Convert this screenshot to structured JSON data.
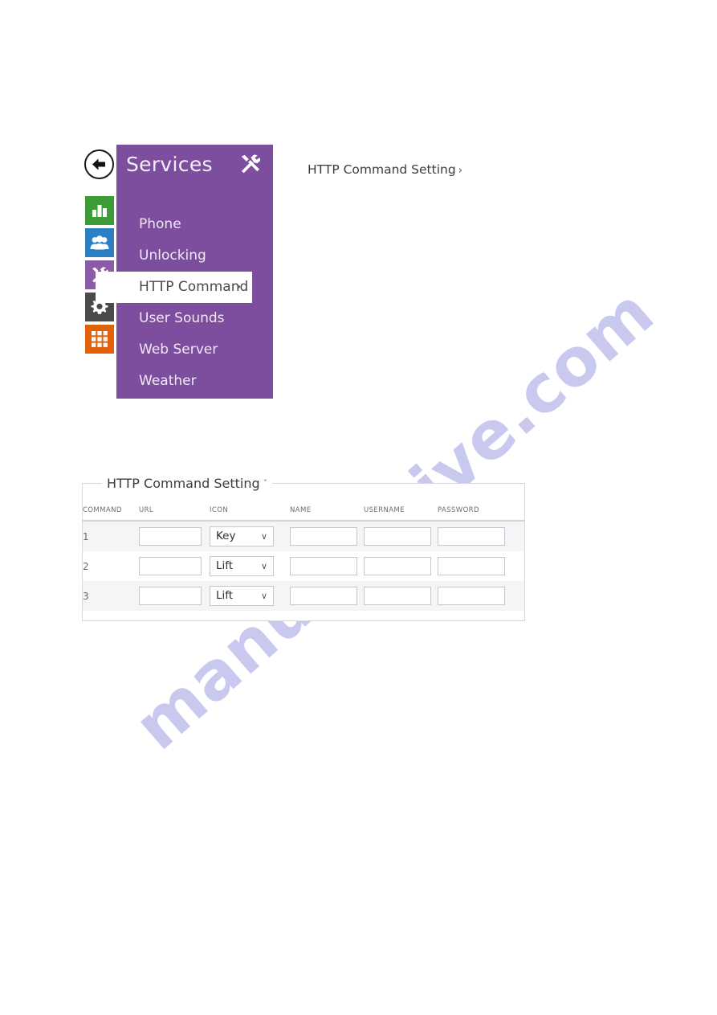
{
  "watermark": {
    "text": "manualshive.com",
    "color": "#c9c9ef"
  },
  "menu_widget": {
    "back_button_icon": "arrow-left-icon",
    "header": {
      "title": "Services",
      "icon": "tools-icon"
    },
    "icon_rail": [
      {
        "name": "status-bar-chart-icon",
        "color": "#3d9b38"
      },
      {
        "name": "directory-users-icon",
        "color": "#2d7fc4"
      },
      {
        "name": "services-tools-icon",
        "color": "#8a5ca8"
      },
      {
        "name": "system-gear-icon",
        "color": "#4a4a4a"
      },
      {
        "name": "apps-grid-icon",
        "color": "#e1600a"
      }
    ],
    "items": [
      {
        "label": "Phone",
        "active": false
      },
      {
        "label": "Unlocking",
        "active": false
      },
      {
        "label": "HTTP Command",
        "active": true,
        "chevron": "›"
      },
      {
        "label": "User Sounds",
        "active": false
      },
      {
        "label": "Web Server",
        "active": false
      },
      {
        "label": "Weather",
        "active": false
      }
    ],
    "panel_color": "#7d4e9e"
  },
  "caption": {
    "text": "HTTP Command Setting",
    "chevron": "›"
  },
  "table_panel": {
    "title": "HTTP Command Setting",
    "title_chevron": "ˇ",
    "columns": [
      "COMMAND",
      "URL",
      "ICON",
      "NAME",
      "USERNAME",
      "PASSWORD"
    ],
    "icon_options": [
      "Key",
      "Lift"
    ],
    "rows": [
      {
        "command": "1",
        "url": "",
        "icon": "Key",
        "name": "",
        "username": "",
        "password": "",
        "stripe": true
      },
      {
        "command": "2",
        "url": "",
        "icon": "Lift",
        "name": "",
        "username": "",
        "password": "",
        "stripe": false
      },
      {
        "command": "3",
        "url": "",
        "icon": "Lift",
        "name": "",
        "username": "",
        "password": "",
        "stripe": true
      }
    ]
  }
}
